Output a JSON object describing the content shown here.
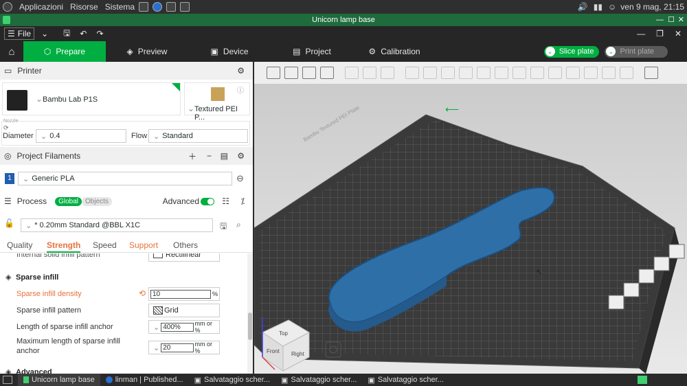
{
  "os_topbar": {
    "menus": [
      "Applicazioni",
      "Risorse",
      "Sistema"
    ],
    "clock": "ven 9 mag, 21:15"
  },
  "window": {
    "title": "Unicorn lamp base"
  },
  "menubar": {
    "file_label": "File"
  },
  "tabs": [
    {
      "label": "Prepare",
      "icon": "cube-icon"
    },
    {
      "label": "Preview",
      "icon": "layers-icon"
    },
    {
      "label": "Device",
      "icon": "device-icon"
    },
    {
      "label": "Project",
      "icon": "project-icon"
    },
    {
      "label": "Calibration",
      "icon": "calibration-icon"
    }
  ],
  "actions": {
    "slice_label": "Slice plate",
    "print_label": "Print plate"
  },
  "printer": {
    "section_label": "Printer",
    "name": "Bambu Lab P1S",
    "plate": "Textured PEI P...",
    "nozzle_label": "Nozzle",
    "diameter_label": "Diameter",
    "diameter_value": "0.4",
    "flow_label": "Flow",
    "flow_value": "Standard"
  },
  "filaments": {
    "section_label": "Project Filaments",
    "items": [
      {
        "index": "1",
        "name": "Generic PLA"
      }
    ]
  },
  "process": {
    "section_label": "Process",
    "global_label": "Global",
    "objects_label": "Objects",
    "advanced_label": "Advanced",
    "profile": "* 0.20mm Standard @BBL X1C",
    "subtabs": [
      "Quality",
      "Strength",
      "Speed",
      "Support",
      "Others"
    ],
    "partial_row_label": "Internal solid infill pattern",
    "partial_row_value": "Rectilinear",
    "sparse_group_label": "Sparse infill",
    "params": [
      {
        "label": "Sparse infill density",
        "value": "10",
        "unit": "%"
      },
      {
        "label": "Sparse infill pattern",
        "value": "Grid",
        "unit": ""
      },
      {
        "label": "Length of sparse infill anchor",
        "value": "400%",
        "unit": "mm or %"
      },
      {
        "label": "Maximum length of sparse infill anchor",
        "value": "20",
        "unit": "mm or %"
      }
    ],
    "next_group_label": "Advanced"
  },
  "viewcube": {
    "top": "Top",
    "front": "Front",
    "right": "Right"
  },
  "bed": {
    "brand_text": "Bambu Textured PEI Plate"
  },
  "taskbar": {
    "items": [
      "Unicorn lamp base",
      "linman | Published...",
      "Salvataggio scher...",
      "Salvataggio scher...",
      "Salvataggio scher..."
    ]
  },
  "colors": {
    "accent": "#00ae42",
    "model": "#2f6fa8",
    "warn": "#e8703a"
  }
}
